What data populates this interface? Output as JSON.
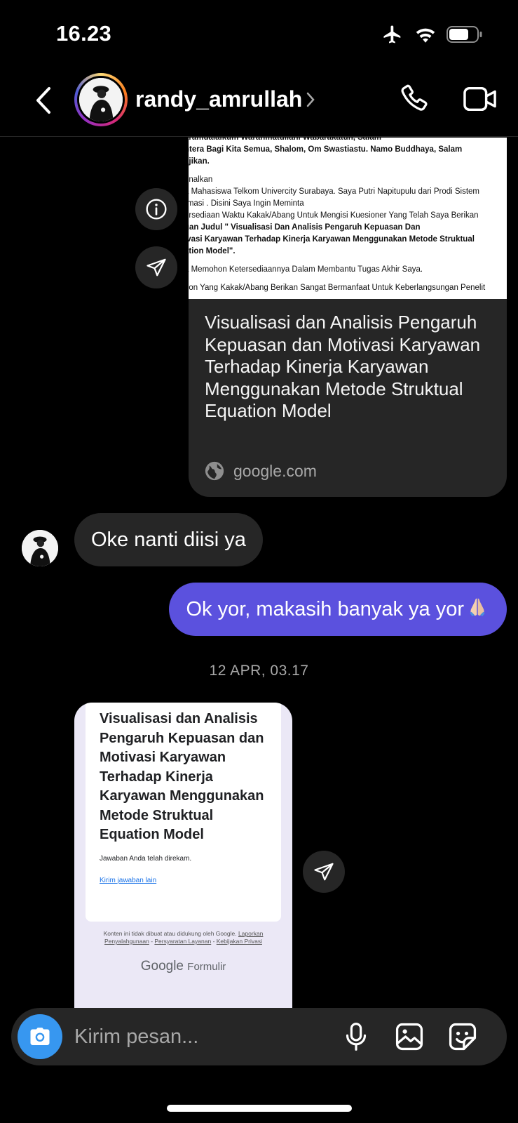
{
  "status_bar": {
    "time": "16.23",
    "icons": [
      "airplane-icon",
      "wifi-icon",
      "battery-icon"
    ]
  },
  "header": {
    "username": "randy_amrullah",
    "icons": [
      "back-icon",
      "chevron-right-icon",
      "phone-icon",
      "video-icon"
    ]
  },
  "shared_link": {
    "preview_lines": [
      "aramualaikum Warahmatullahi Wabarakatuh, Salam",
      "htera Bagi Kita Semua, Shalom, Om Swastiastu. Namo Buddhaya, Salam",
      "ajikan.",
      "",
      "enalkan",
      "a  Mahasiswa Telkom Univercity Surabaya. Saya Putri Napitupulu dari Prodi Sistem",
      "rmasi . Disini Saya  Ingin Meminta",
      "ersediaan Waktu Kakak/Abang Untuk Mengisi Kuesioner Yang Telah Saya Berikan",
      "gan Judul \" Visualisasi Dan Analisis Pengaruh Kepuasan Dan",
      "ivasi Karyawan Terhadap Kinerja Karyawan Menggunakan Metode Struktual",
      "ation Model\".",
      "",
      "a Memohon Ketersediaannya Dalam Membantu Tugas Akhir Saya.",
      "",
      "bon Yang Kakak/Abang  Berikan Sangat Bermanfaat Untuk Keberlangsungan Penelit"
    ],
    "title": "Visualisasi dan Analisis Pengaruh Kepuasan dan Motivasi Karyawan Terhadap Kinerja Karyawan Menggunakan Metode Struktual Equation Model",
    "domain": "google.com"
  },
  "messages": {
    "incoming_1": "Oke nanti diisi ya",
    "outgoing_1": "Ok yor, makasih banyak ya yor",
    "date_separator": "12 APR, 03.17"
  },
  "form_card": {
    "title": "Visualisasi dan Analisis Pengaruh Kepuasan dan Motivasi Karyawan Terhadap Kinerja Karyawan Menggunakan Metode Struktual Equation Model",
    "recorded": "Jawaban Anda telah direkam.",
    "another_response": "Kirim jawaban lain",
    "footer_text": "Konten ini tidak dibuat atau didukung oleh Google.",
    "footer_link_report": "Laporkan Penyalahgunaan",
    "footer_link_terms": "Persyaratan Layanan",
    "footer_link_privacy": "Kebijakan Privasi",
    "brand_google": "Google",
    "brand_formulir": "Formulir"
  },
  "composer": {
    "placeholder": "Kirim pesan...",
    "icons": [
      "camera-icon",
      "microphone-icon",
      "gallery-icon",
      "sticker-icon"
    ]
  },
  "colors": {
    "background": "#000000",
    "bubble_incoming": "#262626",
    "bubble_outgoing": "#5b51de",
    "camera_button": "#3797f0",
    "muted_text": "#a8a8a8"
  }
}
